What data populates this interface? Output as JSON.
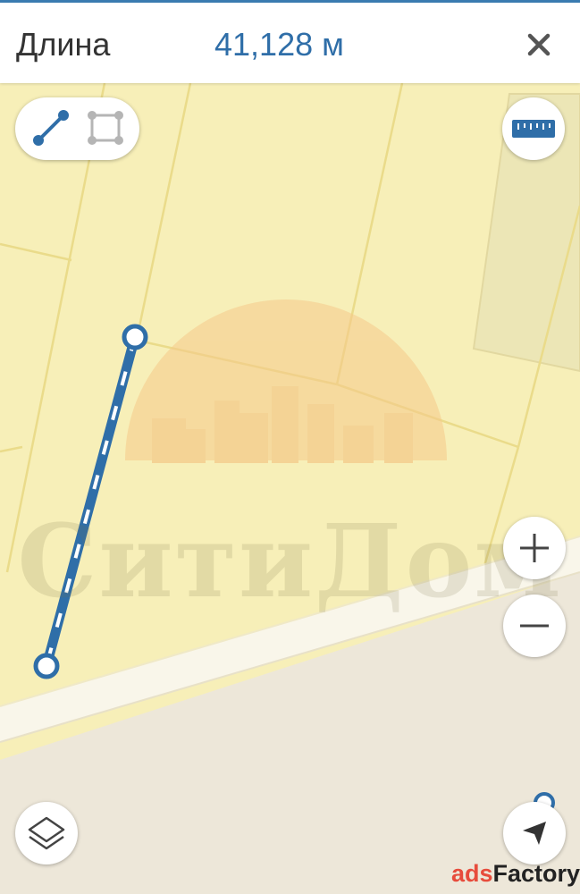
{
  "header": {
    "label": "Длина",
    "value": "41,128 м",
    "close_icon": "close-icon"
  },
  "map": {
    "watermark": "СитиДом",
    "measure_color": "#2f6ea8",
    "plot_color": "#f7efb8",
    "road_color": "#ede7d9"
  },
  "controls": {
    "mode_toggle": {
      "active": "line-mode",
      "icons": [
        "line-measure-icon",
        "area-measure-icon"
      ]
    },
    "ruler": "ruler-icon",
    "zoom_in": "plus-icon",
    "zoom_out": "minus-icon",
    "layers": "layers-icon",
    "compass": "compass-icon"
  },
  "badge": {
    "ads": "ads",
    "factory": "Factory"
  }
}
